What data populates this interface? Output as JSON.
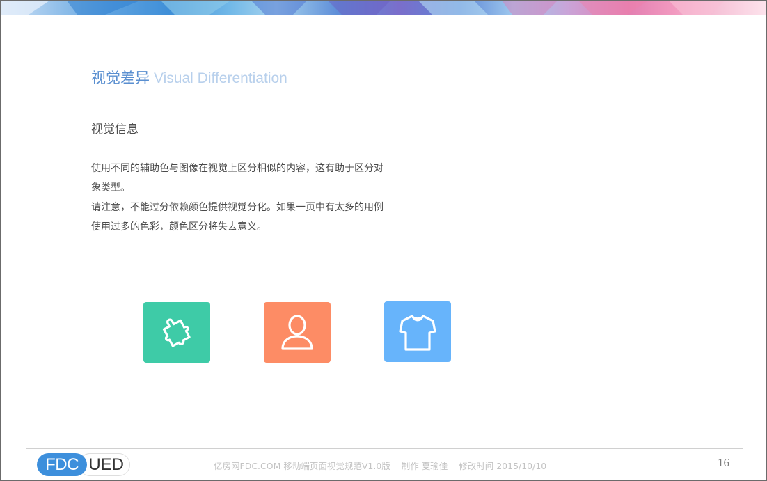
{
  "slide": {
    "title_cn": "视觉差异",
    "title_en": "Visual Differentiation",
    "subtitle": "视觉信息",
    "paragraphs": [
      "使用不同的辅助色与图像在视觉上区分相似的内容，这有助于区分对象类型。",
      "请注意，不能过分依赖颜色提供视觉分化。如果一页中有太多的用例使用过多的色彩，颜色区分将失去意义。"
    ],
    "icons": [
      {
        "name": "puzzle-icon",
        "color": "#3ecba7"
      },
      {
        "name": "user-icon",
        "color": "#fd8c65"
      },
      {
        "name": "shirt-icon",
        "color": "#67b4fb"
      }
    ]
  },
  "footer": {
    "logo_left": "FDC",
    "logo_right": "UED",
    "doc_title": "亿房网FDC.COM 移动端页面视觉规范V1.0版",
    "author": "制作 夏瑜佳",
    "modified": "修改时间   2015/10/10",
    "page_number": "16"
  },
  "colors": {
    "title_cn": "#5a8fd0",
    "title_en": "#b8d0ec",
    "logo_blue": "#3d8fdc"
  }
}
